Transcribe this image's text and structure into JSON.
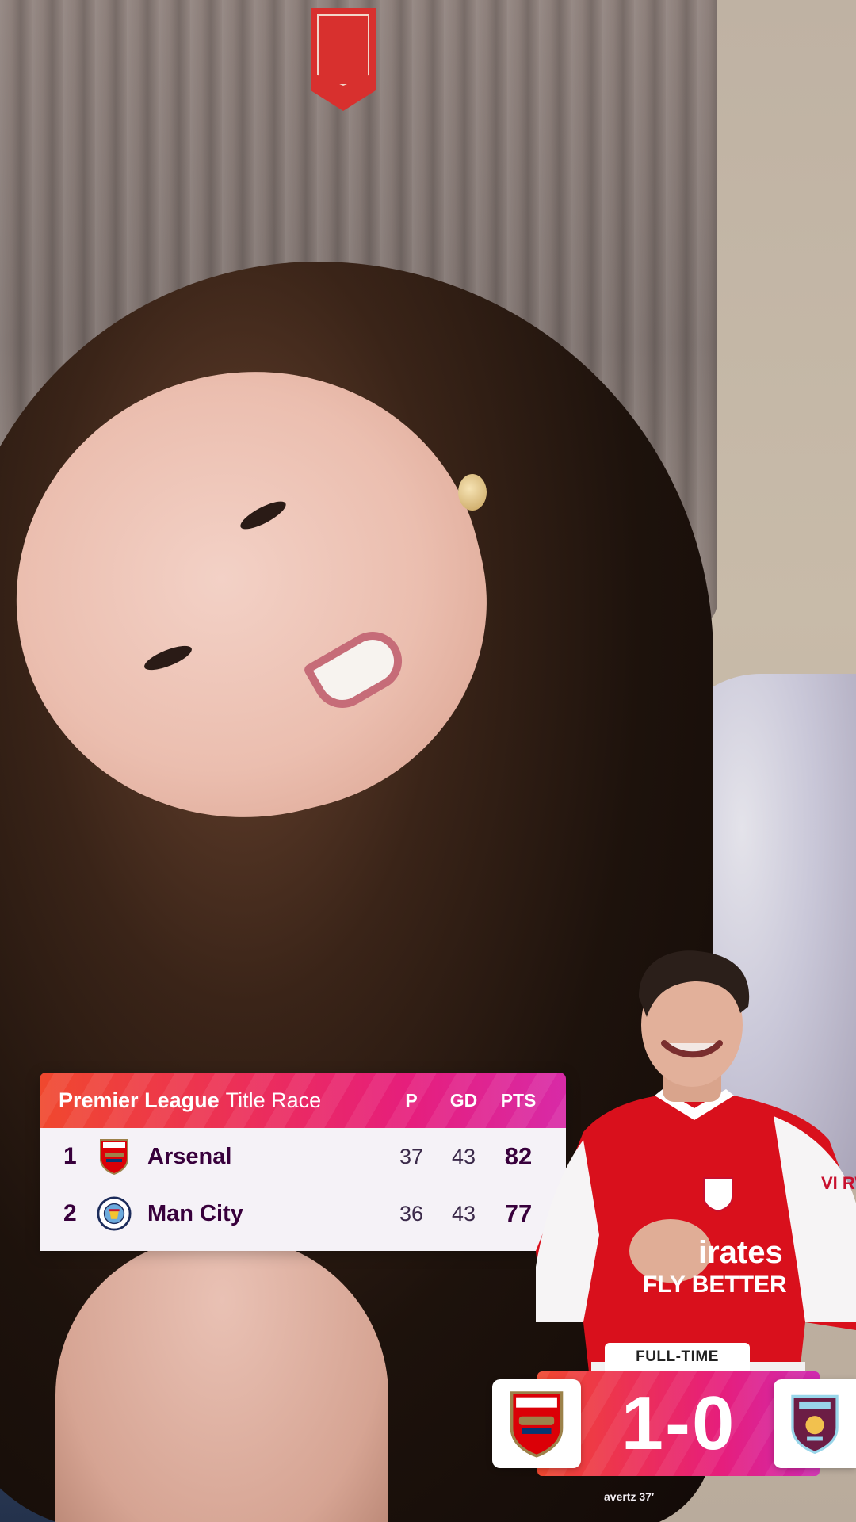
{
  "scene": {
    "description_colors": {
      "accent": "#e61e7c",
      "accent_start": "#f0482e",
      "league_purple": "#38003c"
    }
  },
  "title_race": {
    "title_bold": "Premier League",
    "title_light": "Title Race",
    "headers": {
      "played": "P",
      "goal_diff": "GD",
      "points": "PTS"
    },
    "rows": [
      {
        "position": "1",
        "team": "Arsenal",
        "crest": "arsenal-crest-icon",
        "played": "37",
        "goal_diff": "43",
        "points": "82"
      },
      {
        "position": "2",
        "team": "Man City",
        "crest": "man-city-crest-icon",
        "played": "36",
        "goal_diff": "43",
        "points": "77"
      }
    ]
  },
  "scoreboard": {
    "status": "FULL-TIME",
    "score": "1-0",
    "home_crest": "arsenal-crest-icon",
    "away_crest": "burnley-crest-icon",
    "scorer_line": "avertz 37′"
  },
  "player": {
    "shirt_sponsor_line1": "irates",
    "shirt_sponsor_line2": "FLY BETTER",
    "sleeve_text": "VI RWA"
  }
}
